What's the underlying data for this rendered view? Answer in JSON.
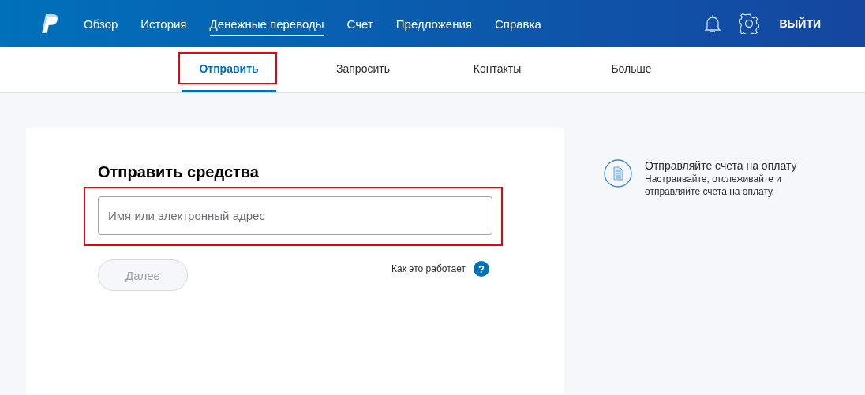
{
  "nav": {
    "items": [
      {
        "label": "Обзор",
        "selected": false
      },
      {
        "label": "История",
        "selected": false
      },
      {
        "label": "Денежные переводы",
        "selected": true
      },
      {
        "label": "Счет",
        "selected": false
      },
      {
        "label": "Предложения",
        "selected": false
      },
      {
        "label": "Справка",
        "selected": false
      }
    ],
    "logout": "ВЫЙТИ"
  },
  "subnav": {
    "tabs": [
      {
        "label": "Отправить",
        "selected": true,
        "highlighted": true
      },
      {
        "label": "Запросить",
        "selected": false,
        "highlighted": false
      },
      {
        "label": "Контакты",
        "selected": false,
        "highlighted": false
      },
      {
        "label": "Больше",
        "selected": false,
        "highlighted": false
      }
    ]
  },
  "send": {
    "title": "Отправить средства",
    "field": {
      "placeholder": "Имя или электронный адрес",
      "highlighted": true
    },
    "next_button": {
      "label": "Далее",
      "disabled": true
    },
    "help_link": "Как это работает",
    "help_icon": "?"
  },
  "promo": {
    "title": "Отправляйте счета на оплату",
    "text": "Настраивайте, отслеживайте и отправляйте счета на оплату."
  }
}
